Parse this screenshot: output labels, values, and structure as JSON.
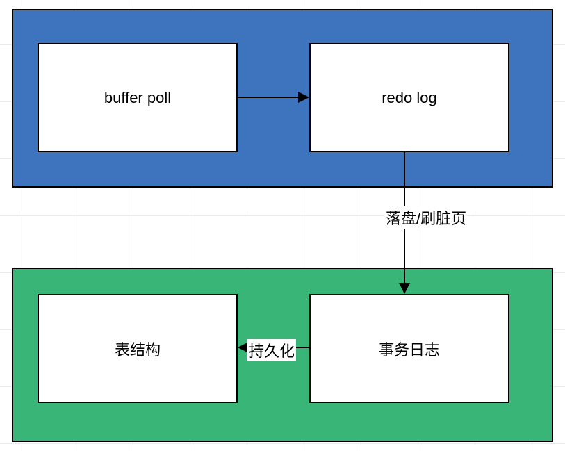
{
  "top_container": {
    "color": "#3e74bd",
    "boxes": {
      "buffer_poll": {
        "label": "buffer poll"
      },
      "redo_log": {
        "label": "redo log"
      }
    }
  },
  "bottom_container": {
    "color": "#38b577",
    "boxes": {
      "table_struct": {
        "label": "表结构"
      },
      "tx_log": {
        "label": "事务日志"
      }
    }
  },
  "edges": {
    "buffer_to_redo": {
      "from": "buffer_poll",
      "to": "redo_log",
      "label": ""
    },
    "redo_to_tx": {
      "from": "redo_log",
      "to": "tx_log",
      "label": "落盘/刷脏页"
    },
    "tx_to_table": {
      "from": "tx_log",
      "to": "table_struct",
      "label": "持久化"
    }
  }
}
